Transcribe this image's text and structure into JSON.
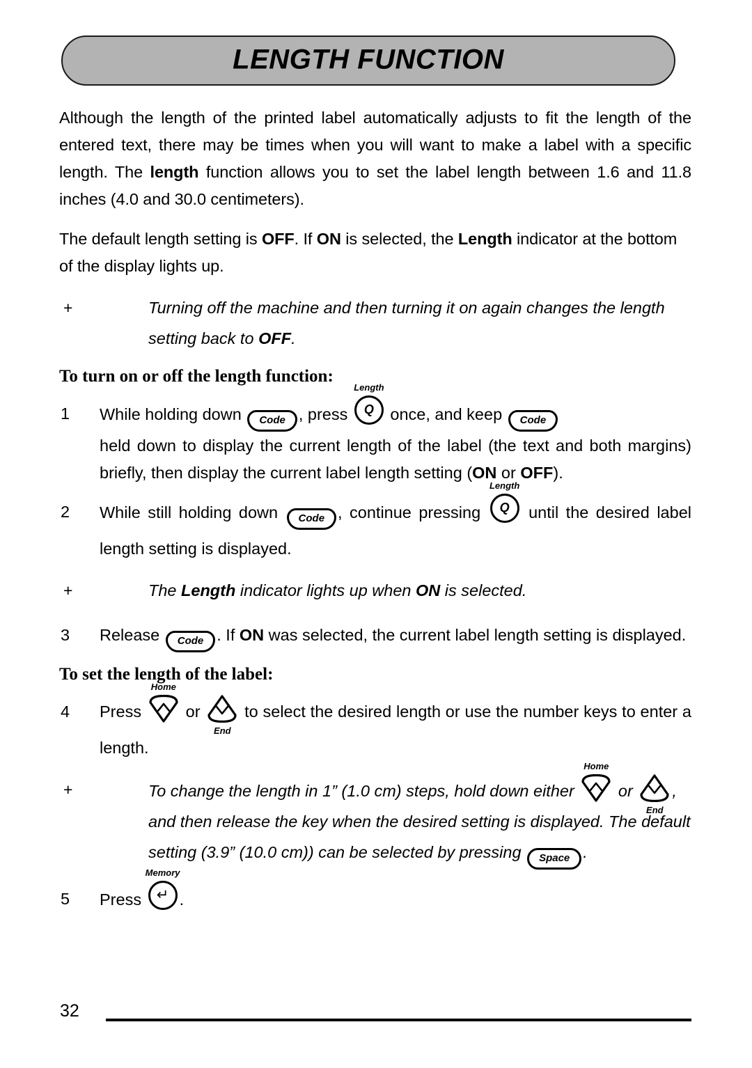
{
  "banner": {
    "title": "LENGTH FUNCTION",
    "fill_color": "#b3b3b3",
    "border_color": "#1a1a1a"
  },
  "paragraphs": {
    "intro_1": "Although the length of the printed label automatically adjusts to fit the length of the entered text, there may be times when you will want to make a label with a specific length. The ",
    "intro_1_bold": "length",
    "intro_1_cont": " function allows you to set the label length between 1.6 and 11.8 inches (4.0 and 30.0 centimeters).",
    "intro_2_a": "The default length setting is ",
    "intro_2_off": "OFF",
    "intro_2_b": ". If ",
    "intro_2_on": "ON",
    "intro_2_c": " is selected, the ",
    "intro_2_length": "Length",
    "intro_2_d": " indicator at the bottom of the display lights up."
  },
  "notes": {
    "bullet": "+",
    "note_1_a": "Turning off the machine and then turning it on again changes the length setting back to ",
    "note_1_off": "OFF",
    "note_1_b": ".",
    "note_2_a": "The ",
    "note_2_length": "Length",
    "note_2_b": " indicator lights up when ",
    "note_2_on": "ON",
    "note_2_c": " is selected.",
    "note_3_a": "To change the length in 1” (1.0 cm) steps, hold down either ",
    "note_3_b": " or ",
    "note_3_c": ", and then release the key when the desired setting is displayed.",
    "note_4_a": "The default setting (3.9” (10.0 cm)) can be selected by pressing ",
    "note_4_b": "."
  },
  "headings": {
    "turn_on_off": "To turn on or off the length function:",
    "set_length": "To set the length of the label:"
  },
  "steps": {
    "one": {
      "num": "1",
      "a": "While holding down ",
      "b": ", press ",
      "c": " once, and keep ",
      "d": " held down to display the current length of the label (the text and both margins) briefly, then display the current label length setting (",
      "on": "ON",
      "e": " or ",
      "off": "OFF",
      "f": ")."
    },
    "two": {
      "num": "2",
      "a": "While still holding down ",
      "b": ", continue pressing ",
      "c": " until the desired label length setting is displayed."
    },
    "three": {
      "num": "3",
      "a": "Release ",
      "b": ". If ",
      "on": "ON",
      "c": " was selected, the current label length setting is displayed."
    },
    "four": {
      "num": "4",
      "a": "Press ",
      "b": " or ",
      "c": " to select the desired length or use the number keys to enter a length."
    },
    "five": {
      "num": "5",
      "a": "Press ",
      "b": "."
    }
  },
  "keys": {
    "code": "Code",
    "space": "Space",
    "q": "Q",
    "q_label": "Length",
    "home_label": "Home",
    "end_label": "End",
    "memory_label": "Memory",
    "memory_glyph": "↵",
    "up_glyph": "∧",
    "down_glyph": "∨"
  },
  "footer": {
    "page_number": "32"
  }
}
